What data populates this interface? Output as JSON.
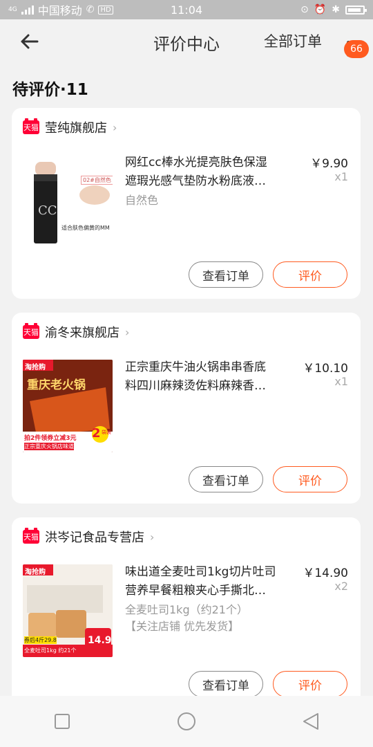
{
  "status_bar": {
    "carrier": "中国移动",
    "network_tag": "4G",
    "hd_tag": "HD",
    "time": "11:04"
  },
  "header": {
    "title": "评价中心",
    "right_link": "全部订单",
    "badge_count": "66",
    "icons": [
      "back-arrow-icon",
      "more-icon"
    ]
  },
  "section": {
    "title": "待评价·11"
  },
  "orders": [
    {
      "store": "莹纯旗舰店",
      "store_badge": "天猫",
      "title": "网红cc棒水光提亮肤色保湿遮瑕光感气垫防水粉底液…",
      "variant": "自然色",
      "variant2": "",
      "price": "￥9.90",
      "qty": "x1",
      "thumb_labels": [
        "CC",
        "02#自然色",
        "适合肤色偏黄的MM"
      ],
      "view_label": "查看订单",
      "rate_label": "评价"
    },
    {
      "store": "渝冬来旗舰店",
      "store_badge": "天猫",
      "title": "正宗重庆牛油火锅串串香底料四川麻辣烫佐料麻辣香…",
      "variant": "",
      "variant2": "",
      "price": "￥10.10",
      "qty": "x1",
      "thumb_labels": [
        "淘抢购",
        "重庆老火锅",
        "拍2件领券立减3元",
        "正宗重庆火锅店味道",
        "2",
        "袋装"
      ],
      "view_label": "查看订单",
      "rate_label": "评价"
    },
    {
      "store": "洪岑记食品专营店",
      "store_badge": "天猫",
      "title": "味出道全麦吐司1kg切片吐司营养早餐粗粮夹心手撕北…",
      "variant": "全麦吐司1kg（约21个）",
      "variant2": "【关注店铺 优先发货】",
      "price": "￥14.90",
      "qty": "x2",
      "thumb_labels": [
        "淘抢购",
        "券后4斤29.8",
        "全麦吐司1kg 约21个",
        "14.9"
      ],
      "view_label": "查看订单",
      "rate_label": "评价"
    }
  ],
  "nav_bar": {
    "icons": [
      "square-icon",
      "circle-icon",
      "triangle-back-icon"
    ]
  },
  "colors": {
    "accent": "#ff5a1f",
    "tmall": "#ff0036",
    "background": "#f2f2f2"
  }
}
